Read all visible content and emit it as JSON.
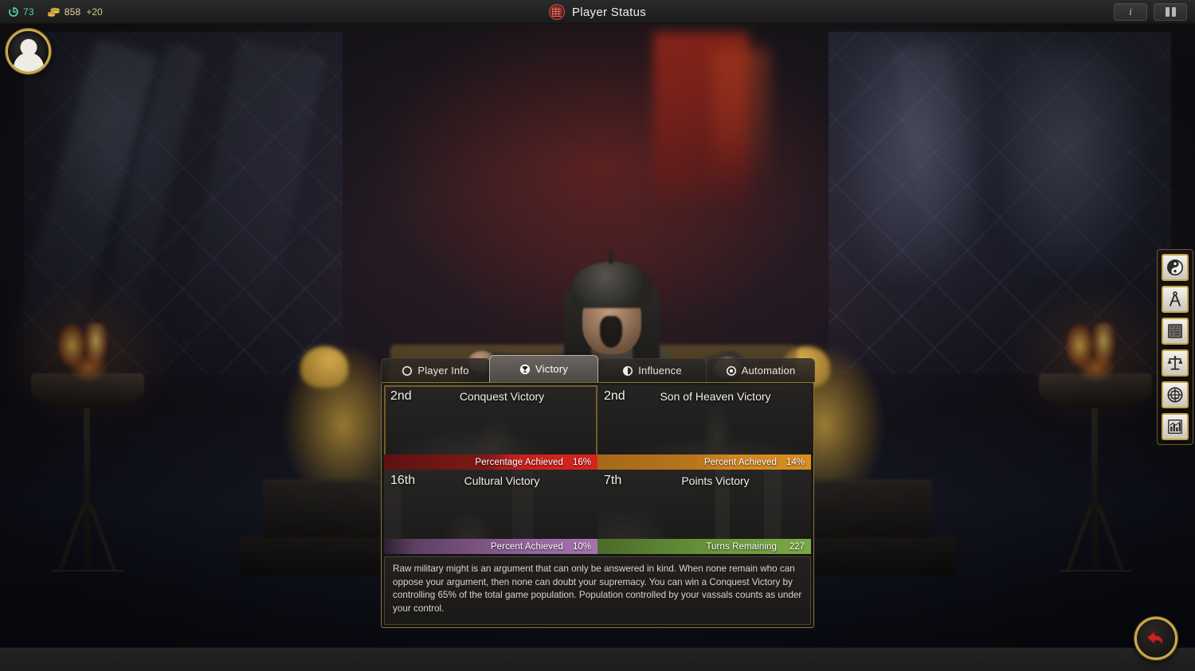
{
  "topbar": {
    "turn_icon": "turn-cycle-icon",
    "turn_value": "73",
    "gold_icon": "gold-coins-icon",
    "gold_value": "858",
    "gold_income": "+20",
    "seal_icon": "red-seal-icon",
    "title": "Player Status",
    "info_button_label": "i",
    "info_icon": "info-icon",
    "pause_icon": "pause-icon"
  },
  "avatar": {
    "icon": "player-portrait-icon"
  },
  "sidebar": {
    "items": [
      {
        "name": "yin-yang-icon",
        "label": "Religion"
      },
      {
        "name": "compass-icon",
        "label": "Technology"
      },
      {
        "name": "scroll-icon",
        "label": "Civics"
      },
      {
        "name": "scales-icon",
        "label": "Laws"
      },
      {
        "name": "globe-seal-icon",
        "label": "Diplomacy"
      },
      {
        "name": "bar-chart-icon",
        "label": "Statistics"
      }
    ]
  },
  "back_button": {
    "icon": "back-arrow-icon"
  },
  "panel": {
    "tabs": [
      {
        "label": "Player Info",
        "icon": "circle-outline-icon",
        "active": false
      },
      {
        "label": "Victory",
        "icon": "trophy-icon",
        "active": true
      },
      {
        "label": "Influence",
        "icon": "half-circle-icon",
        "active": false
      },
      {
        "label": "Automation",
        "icon": "target-dot-icon",
        "active": false
      }
    ],
    "victories": [
      {
        "rank": "2nd",
        "title": "Conquest Victory",
        "bar_label": "Percentage Achieved",
        "bar_value": "16%",
        "bar_color": "#d8241f",
        "progress": 16,
        "selected": true
      },
      {
        "rank": "2nd",
        "title": "Son of Heaven Victory",
        "bar_label": "Percent Achieved",
        "bar_value": "14%",
        "bar_color": "#d98d22",
        "progress": 14,
        "selected": false
      },
      {
        "rank": "16th",
        "title": "Cultural Victory",
        "bar_label": "Percent Achieved",
        "bar_value": "10%",
        "bar_color": "#a573af",
        "progress": 10,
        "selected": false
      },
      {
        "rank": "7th",
        "title": "Points Victory",
        "bar_label": "Turns Remaining",
        "bar_value": "227",
        "bar_color": "#7aa844",
        "progress": 100,
        "selected": false
      }
    ],
    "description": "Raw military might is an argument that can only be answered in kind. When none remain who can oppose your argument, then none can doubt your supremacy. You can win a Conquest Victory by controlling 65% of the total game population. Population controlled by your vassals counts as under your control."
  }
}
